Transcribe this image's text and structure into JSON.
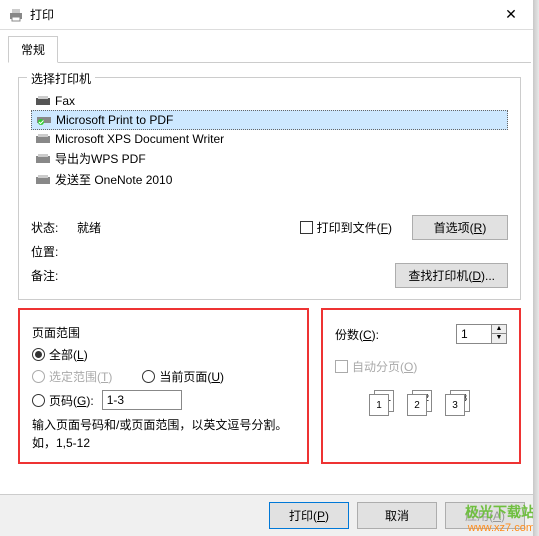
{
  "window": {
    "title": "打印",
    "close": "✕"
  },
  "tab": {
    "general": "常规"
  },
  "printer_group": {
    "title": "选择打印机",
    "items": [
      {
        "name": "Fax"
      },
      {
        "name": "Microsoft Print to PDF"
      },
      {
        "name": "Microsoft XPS Document Writer"
      },
      {
        "name": "导出为WPS PDF"
      },
      {
        "name": "发送至 OneNote 2010"
      }
    ],
    "status_label": "状态:",
    "status_value": "就绪",
    "location_label": "位置:",
    "comment_label": "备注:",
    "print_to_file": "打印到文件(F)",
    "preferences_btn": "首选项(R)",
    "find_printer_btn": "查找打印机(D)..."
  },
  "range": {
    "title": "页面范围",
    "all": "全部(L)",
    "selection": "选定范围(T)",
    "current": "当前页面(U)",
    "pages": "页码(G):",
    "pages_value": "1-3",
    "hint": "输入页面号码和/或页面范围，以英文逗号分割。如，1,5-12"
  },
  "copies": {
    "label": "份数(C):",
    "value": "1",
    "collate": "自动分页(O)",
    "illust": [
      {
        "front": "1",
        "back": "1"
      },
      {
        "front": "2",
        "back": "2"
      },
      {
        "front": "3",
        "back": "3"
      }
    ]
  },
  "footer": {
    "print": "打印(P)",
    "cancel": "取消",
    "apply": "应用(A)"
  },
  "watermark": {
    "cn": "极光下载站",
    "url": "www.xz7.com"
  }
}
